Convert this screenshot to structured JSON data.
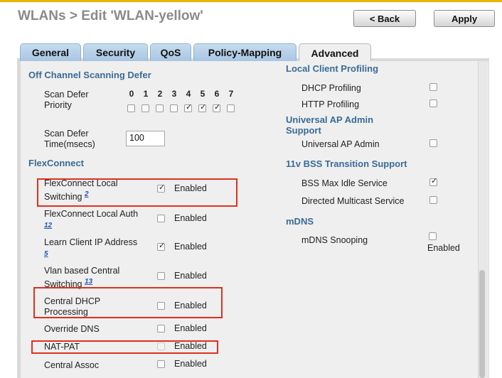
{
  "header": {
    "title": "WLANs > Edit   'WLAN-yellow'",
    "back_label": "< Back",
    "apply_label": "Apply"
  },
  "tabs": [
    {
      "label": "General"
    },
    {
      "label": "Security"
    },
    {
      "label": "QoS"
    },
    {
      "label": "Policy-Mapping"
    },
    {
      "label": "Advanced",
      "active": true
    }
  ],
  "left": {
    "off_channel": {
      "title": "Off Channel Scanning Defer",
      "priority_label": "Scan Defer Priority",
      "priorities": [
        {
          "digit": "0",
          "checked": false
        },
        {
          "digit": "1",
          "checked": false
        },
        {
          "digit": "2",
          "checked": false
        },
        {
          "digit": "3",
          "checked": false
        },
        {
          "digit": "4",
          "checked": true
        },
        {
          "digit": "5",
          "checked": true
        },
        {
          "digit": "6",
          "checked": true
        },
        {
          "digit": "7",
          "checked": false
        }
      ],
      "time_label": "Scan Defer Time(msecs)",
      "time_value": "100"
    },
    "flexconnect": {
      "title": "FlexConnect",
      "enabled_text": "Enabled",
      "rows": [
        {
          "label": "FlexConnect Local Switching",
          "footnote": "2",
          "checked": true
        },
        {
          "label": "FlexConnect Local Auth",
          "footnote": "12",
          "checked": false
        },
        {
          "label": "Learn Client IP Address",
          "footnote": "5",
          "checked": true
        },
        {
          "label": "Vlan based Central Switching",
          "footnote": "13",
          "checked": false
        },
        {
          "label": "Central DHCP Processing",
          "checked": false
        },
        {
          "label": "Override DNS",
          "checked": false
        },
        {
          "label": "NAT-PAT",
          "checked": false,
          "disabled": true
        },
        {
          "label": "Central Assoc",
          "checked": false
        }
      ]
    }
  },
  "right": {
    "profiling": {
      "title": "Local Client Profiling",
      "dhcp": "DHCP Profiling",
      "http": "HTTP Profiling"
    },
    "ap_admin": {
      "title": "Universal AP Admin Support",
      "row": "Universal AP Admin"
    },
    "bss": {
      "title": "11v BSS Transition Support",
      "idle": "BSS Max Idle Service",
      "multicast": "Directed Multicast Service"
    },
    "mdns": {
      "title": "mDNS",
      "row": "mDNS Snooping",
      "enabled_text": "Enabled"
    }
  },
  "colors": {
    "highlight": "#e0301e",
    "section": "#3a6b96",
    "tab": "#b3cde6"
  }
}
